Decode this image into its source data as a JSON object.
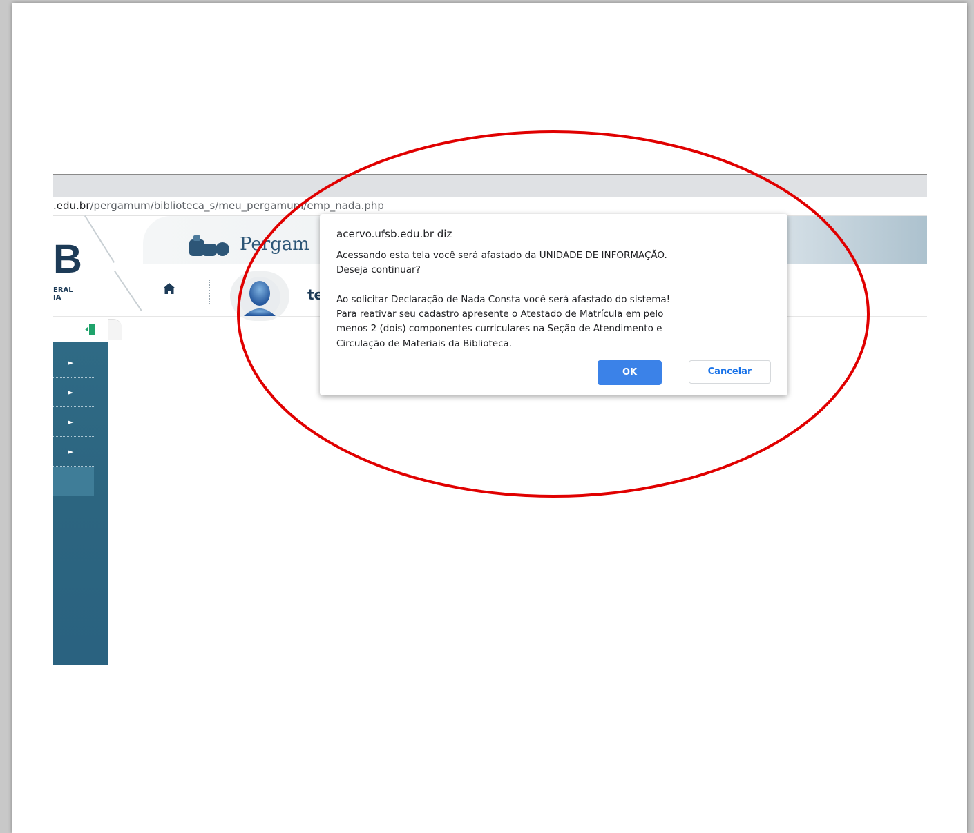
{
  "browser": {
    "url_host": ".edu.br",
    "url_path": "/pergamum/biblioteca_s/meu_pergamum/emp_nada.php"
  },
  "header": {
    "university_mark": "B",
    "university_sub_line1": "ERAL",
    "university_sub_line2": "IA",
    "pergamum_brand": "Pergam",
    "user_name_partial": "te",
    "icons": {
      "home": "home-icon",
      "avatar": "user-avatar-icon",
      "collapse": "sidebar-collapse-icon"
    }
  },
  "sidebar": {
    "items": [
      {
        "arrow": "►"
      },
      {
        "arrow": "►"
      },
      {
        "arrow": "►"
      },
      {
        "arrow": "►"
      },
      {
        "arrow": ""
      }
    ]
  },
  "dialog": {
    "origin": "acervo.ufsb.edu.br diz",
    "message": "Acessando esta tela você será afastado da UNIDADE DE INFORMAÇÃO.\nDeseja continuar?\n\nAo solicitar Declaração de Nada Consta você será afastado do sistema!\nPara reativar seu cadastro apresente o Atestado de Matrícula em pelo\nmenos 2 (dois) componentes curriculares na Seção de Atendimento e\nCirculação de Materiais da Biblioteca.",
    "ok_label": "OK",
    "cancel_label": "Cancelar"
  },
  "colors": {
    "annotation_ellipse": "#e00000",
    "ok_button": "#3b82e8",
    "sidebar": "#2c6580",
    "brand_dark": "#1d3b57"
  }
}
